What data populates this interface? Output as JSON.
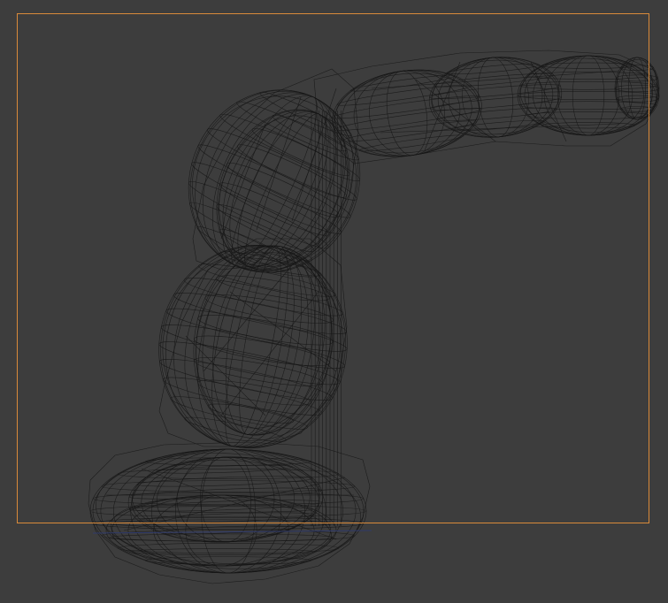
{
  "viewport": {
    "background_color": "#3d3d3d",
    "shading_mode": "wireframe",
    "wire_color": "#161616",
    "camera_frame_color": "#d98a3a",
    "ground_line_color": "#2f3a6b"
  },
  "object": {
    "segments": [
      "base",
      "lower-arm",
      "elbow-joint",
      "upper-arm",
      "hand"
    ]
  }
}
